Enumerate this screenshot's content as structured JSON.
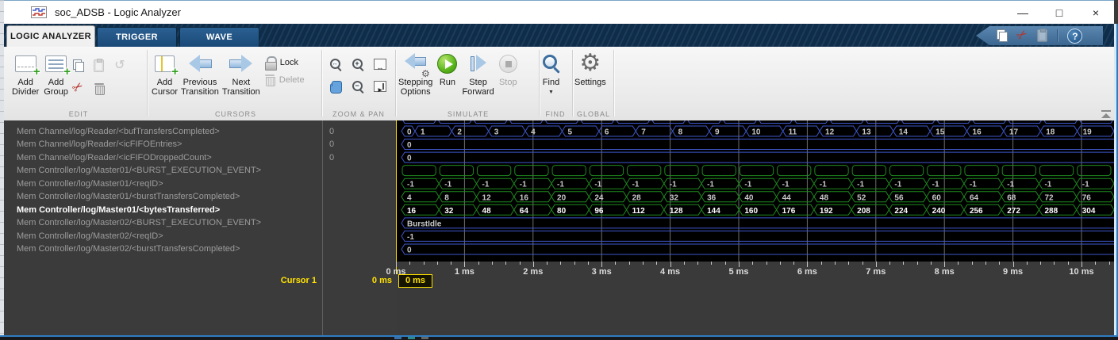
{
  "titlebar": {
    "title": "soc_ADSB - Logic Analyzer",
    "minimize": "—",
    "maximize": "□",
    "close": "×"
  },
  "tabs": {
    "logic_analyzer": "LOGIC ANALYZER",
    "trigger": "TRIGGER",
    "wave": "WAVE"
  },
  "ribbon": {
    "sections": {
      "edit": "EDIT",
      "cursors": "CURSORS",
      "zoom_pan": "ZOOM & PAN",
      "simulate": "SIMULATE",
      "find": "FIND",
      "global_label": "GLOBAL"
    },
    "add_divider": "Add\nDivider",
    "add_group": "Add\nGroup",
    "add_cursor": "Add\nCursor",
    "previous_transition": "Previous\nTransition",
    "next_transition": "Next\nTransition",
    "lock": "Lock",
    "delete": "Delete",
    "stepping_options": "Stepping\nOptions",
    "run": "Run",
    "step_forward": "Step\nForward",
    "stop": "Stop",
    "find": "Find",
    "settings": "Settings"
  },
  "colors": {
    "bus_blue": "#3e57c9",
    "bus_green": "#1f8a1f",
    "cursor_yellow": "#ffe100",
    "selected_text": "#ffffff",
    "bus_label": "#c9c9c9",
    "gridline": "#6e6e6e"
  },
  "signals": [
    {
      "name": "Mem Channel/log/Reader/<bufTransfersCompleted>",
      "cursor_value": "0",
      "color": "blue",
      "kind": "steps",
      "first_narrow": true,
      "labels": [
        "0",
        "1",
        "2",
        "3",
        "4",
        "5",
        "6",
        "7",
        "8",
        "9",
        "10",
        "11",
        "12",
        "13",
        "14",
        "15",
        "16",
        "17",
        "18",
        "19"
      ]
    },
    {
      "name": "Mem Channel/log/Reader/<icFIFOEntries>",
      "cursor_value": "0",
      "color": "blue",
      "kind": "flat",
      "label": "0"
    },
    {
      "name": "Mem Channel/log/Reader/<icFIFODroppedCount>",
      "cursor_value": "0",
      "color": "blue",
      "kind": "flat",
      "label": "0"
    },
    {
      "name": "Mem Controller/log/Master01/<BURST_EXECUTION_EVENT>",
      "color": "green",
      "kind": "events",
      "labels": [
        "",
        "",
        "",
        "",
        "",
        "",
        "",
        "",
        "",
        "",
        "",
        "",
        "",
        "",
        "",
        "",
        "",
        "",
        ""
      ]
    },
    {
      "name": "Mem Controller/log/Master01/<reqID>",
      "color": "green",
      "kind": "steps",
      "labels": [
        "-1",
        "-1",
        "-1",
        "-1",
        "-1",
        "-1",
        "-1",
        "-1",
        "-1",
        "-1",
        "-1",
        "-1",
        "-1",
        "-1",
        "-1",
        "-1",
        "-1",
        "-1",
        "-1"
      ]
    },
    {
      "name": "Mem Controller/log/Master01/<burstTransfersCompleted>",
      "color": "green",
      "kind": "steps",
      "labels": [
        "4",
        "8",
        "12",
        "16",
        "20",
        "24",
        "28",
        "32",
        "36",
        "40",
        "44",
        "48",
        "52",
        "56",
        "60",
        "64",
        "68",
        "72",
        "76"
      ]
    },
    {
      "name": "Mem Controller/log/Master01/<bytesTransferred>",
      "color": "green",
      "kind": "steps",
      "selected": true,
      "labels": [
        "16",
        "32",
        "48",
        "64",
        "80",
        "96",
        "112",
        "128",
        "144",
        "160",
        "176",
        "192",
        "208",
        "224",
        "240",
        "256",
        "272",
        "288",
        "304"
      ]
    },
    {
      "name": "Mem Controller/log/Master02/<BURST_EXECUTION_EVENT>",
      "color": "blue",
      "kind": "flat",
      "label": "BurstIdle"
    },
    {
      "name": "Mem Controller/log/Master02/<reqID>",
      "color": "blue",
      "kind": "flat",
      "label": "-1"
    },
    {
      "name": "Mem Controller/log/Master02/<burstTransfersCompleted>",
      "color": "blue",
      "kind": "flat",
      "label": "0"
    }
  ],
  "partial_top_row": {
    "color": "blue",
    "segments": 20
  },
  "axis": {
    "tick_labels": [
      "0 ms",
      "1 ms",
      "2 ms",
      "3 ms",
      "4 ms",
      "5 ms",
      "6 ms",
      "7 ms",
      "8 ms",
      "9 ms",
      "10 ms"
    ]
  },
  "cursor": {
    "name": "Cursor 1",
    "time": "0 ms",
    "value_box": "0 ms"
  }
}
